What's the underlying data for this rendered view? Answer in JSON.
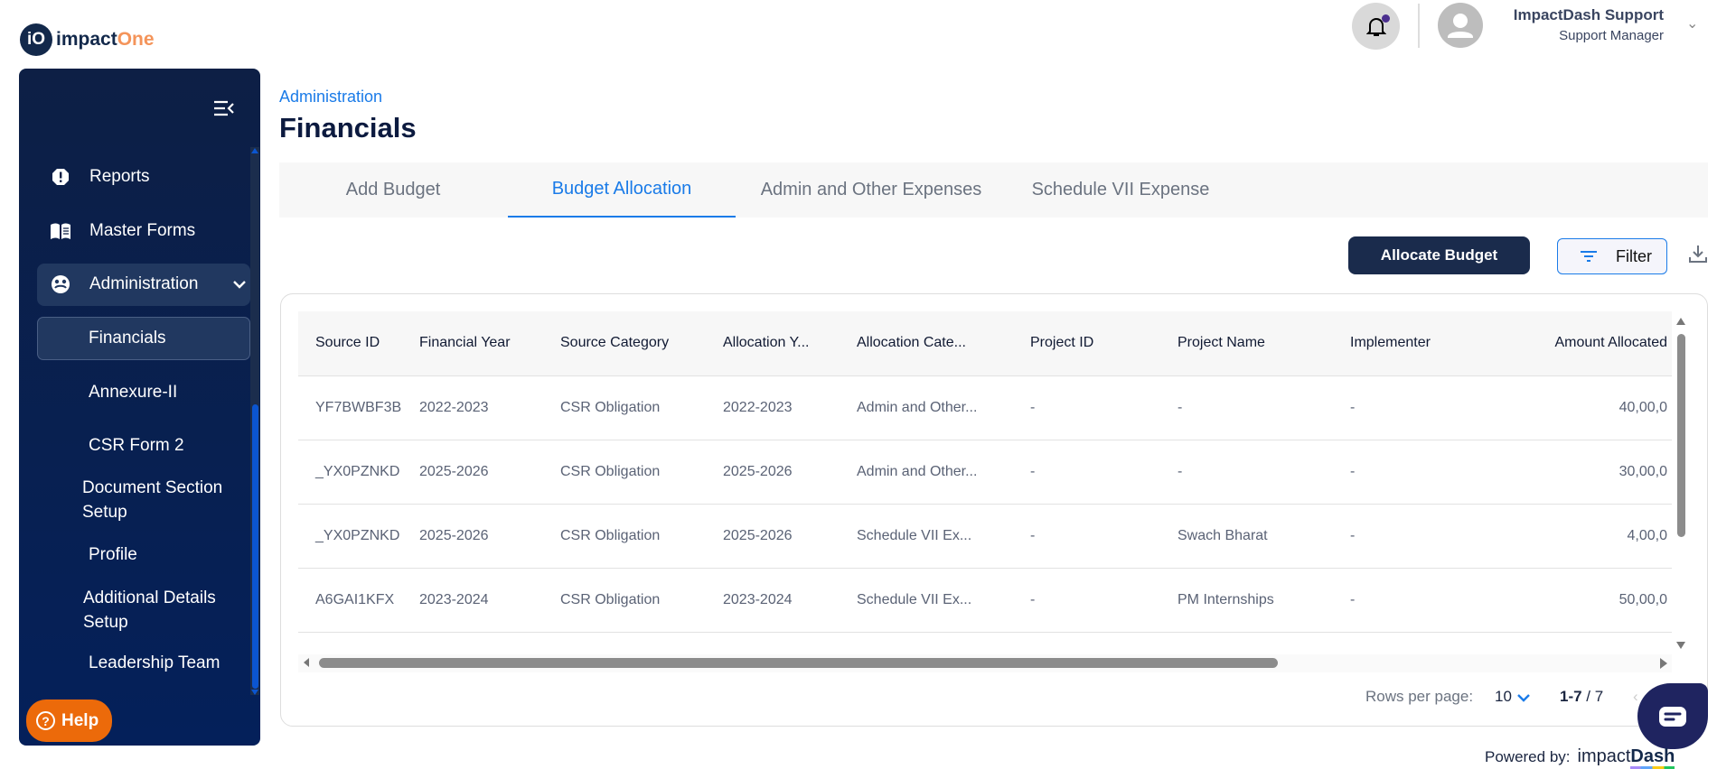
{
  "logo": {
    "mark": "iO",
    "word1": "impact",
    "word2": "One"
  },
  "header": {
    "user_name": "ImpactDash Support",
    "user_role": "Support Manager",
    "notification_dot": true
  },
  "sidebar": {
    "items": [
      {
        "label": "Reports",
        "icon": "alert-octagon-icon"
      },
      {
        "label": "Master Forms",
        "icon": "book-icon"
      },
      {
        "label": "Administration",
        "icon": "admin-icon",
        "expanded": true
      }
    ],
    "subitems": [
      {
        "label": "Financials",
        "active": true
      },
      {
        "label": "Annexure-II"
      },
      {
        "label": "CSR Form 2"
      },
      {
        "label": "Document Section Setup"
      },
      {
        "label": "Profile"
      },
      {
        "label": "Additional Details Setup"
      },
      {
        "label": "Leadership Team"
      }
    ],
    "help_label": "Help"
  },
  "breadcrumb": "Administration",
  "page_title": "Financials",
  "tabs": [
    {
      "label": "Add Budget"
    },
    {
      "label": "Budget Allocation",
      "active": true
    },
    {
      "label": "Admin and Other Expenses"
    },
    {
      "label": "Schedule VII Expense"
    }
  ],
  "toolbar": {
    "allocate_label": "Allocate Budget",
    "filter_label": "Filter"
  },
  "table": {
    "columns": [
      "Source ID",
      "Financial Year",
      "Source Category",
      "Allocation Y...",
      "Allocation Cate...",
      "Project ID",
      "Project Name",
      "Implementer",
      "Amount Allocated"
    ],
    "rows": [
      [
        "YF7BWBF3B",
        "2022-2023",
        "CSR Obligation",
        "2022-2023",
        "Admin and Other...",
        "-",
        "-",
        "-",
        "40,00,0"
      ],
      [
        "_YX0PZNKD",
        "2025-2026",
        "CSR Obligation",
        "2025-2026",
        "Admin and Other...",
        "-",
        "-",
        "-",
        "30,00,0"
      ],
      [
        "_YX0PZNKD",
        "2025-2026",
        "CSR Obligation",
        "2025-2026",
        "Schedule VII Ex...",
        "-",
        "Swach Bharat",
        "-",
        "4,00,0"
      ],
      [
        "A6GAI1KFX",
        "2023-2024",
        "CSR Obligation",
        "2023-2024",
        "Schedule VII Ex...",
        "-",
        "PM Internships",
        "-",
        "50,00,0"
      ]
    ]
  },
  "pagination": {
    "rows_per_page_label": "Rows per page:",
    "rows_per_page": "10",
    "range": "1-7",
    "total": "7"
  },
  "footer": {
    "powered_by": "Powered by:",
    "brand1": "impact",
    "brand2": "Dash"
  },
  "colors": {
    "sidebar": "#0d1f45",
    "accent": "#1a7be8",
    "primary_button": "#1a2b4c",
    "help": "#ec6a0a",
    "chat": "#1f2460"
  }
}
